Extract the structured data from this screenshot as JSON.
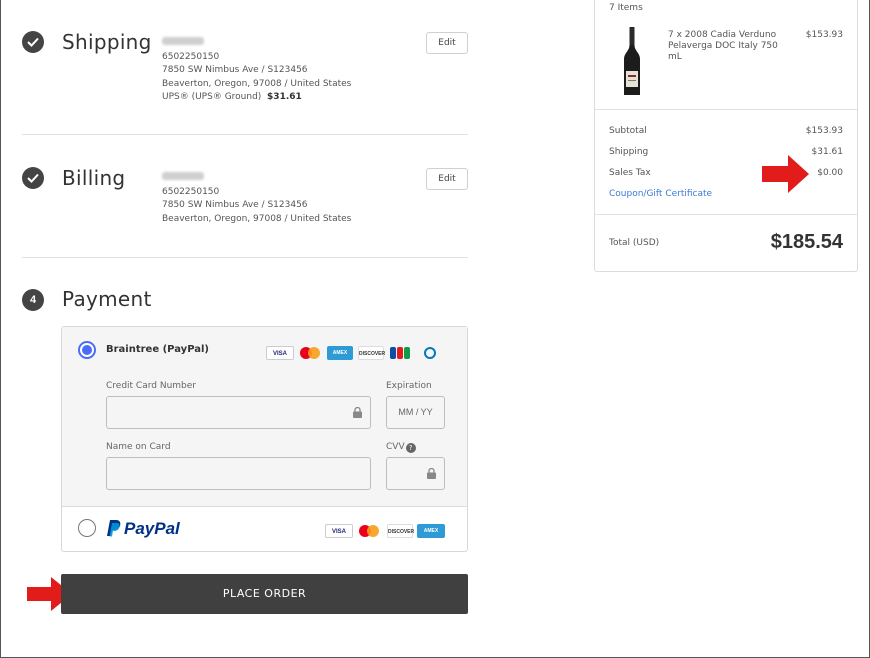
{
  "shipping": {
    "title": "Shipping",
    "phone": "6502250150",
    "street": "7850 SW Nimbus Ave / S123456",
    "city": "Beaverton, Oregon, 97008 / United States",
    "method": "UPS® (UPS® Ground)",
    "cost": "$31.61",
    "edit_label": "Edit"
  },
  "billing": {
    "title": "Billing",
    "phone": "6502250150",
    "street": "7850 SW Nimbus Ave / S123456",
    "city": "Beaverton, Oregon, 97008 / United States",
    "edit_label": "Edit"
  },
  "payment": {
    "step_number": "4",
    "title": "Payment",
    "braintree_label": "Braintree (PayPal)",
    "card_number_label": "Credit Card Number",
    "expiration_label": "Expiration",
    "expiration_placeholder": "MM / YY",
    "name_label": "Name on Card",
    "cvv_label": "CVV",
    "paypal_label": "PayPal",
    "card_icons": [
      "visa",
      "mastercard",
      "amex",
      "discover",
      "jcb",
      "diners"
    ],
    "paypal_card_icons": [
      "visa",
      "mastercard",
      "discover",
      "amex"
    ]
  },
  "place_order_label": "PLACE ORDER",
  "summary": {
    "items_count": "7 Items",
    "item": {
      "description": "7 x 2008 Cadia Verduno Pelaverga DOC Italy 750 mL",
      "price": "$153.93"
    },
    "subtotal_label": "Subtotal",
    "subtotal_value": "$153.93",
    "shipping_label": "Shipping",
    "shipping_value": "$31.61",
    "tax_label": "Sales Tax",
    "tax_value": "$0.00",
    "coupon_label": "Coupon/Gift Certificate",
    "total_label": "Total (USD)",
    "total_value": "$185.54"
  },
  "colors": {
    "accent_radio": "#4a6cf7",
    "button_dark": "#404040",
    "arrow_red": "#e21b1b",
    "link_blue": "#3a7bd5"
  }
}
